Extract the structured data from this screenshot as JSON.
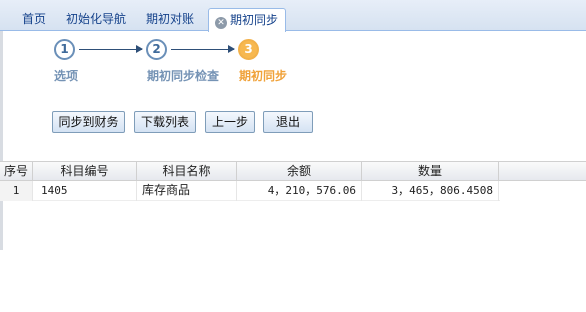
{
  "tabs": [
    {
      "label": "首页"
    },
    {
      "label": "初始化导航"
    },
    {
      "label": "期初对账"
    },
    {
      "label": "期初同步",
      "active": true
    }
  ],
  "wizard": {
    "steps": [
      {
        "number": "1",
        "label": "选项"
      },
      {
        "number": "2",
        "label": "期初同步检查"
      },
      {
        "number": "3",
        "label": "期初同步",
        "active": true
      }
    ],
    "buttons": {
      "sync_finance": "同步到财务",
      "download_list": "下载列表",
      "prev_step": "上一步",
      "exit": "退出"
    }
  },
  "grid": {
    "columns": [
      "序号",
      "科目编号",
      "科目名称",
      "余额",
      "数量"
    ],
    "rows": [
      {
        "index": "1",
        "code": "1405",
        "name": "库存商品",
        "balance": "4，210，576.06",
        "quantity": "3，465，806.4508"
      }
    ]
  },
  "colors": {
    "active_step": "#f7b850",
    "inactive_step": "#6a8fb8",
    "tab_text": "#15428b"
  }
}
